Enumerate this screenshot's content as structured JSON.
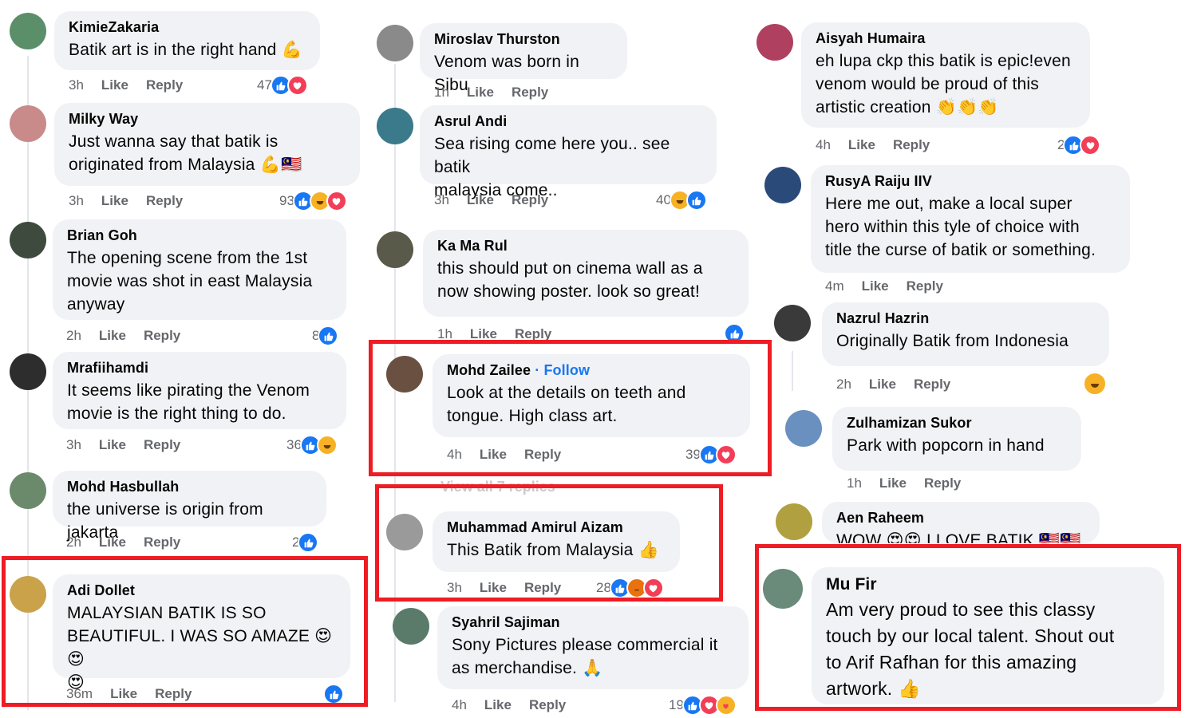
{
  "ui": {
    "like": "Like",
    "reply": "Reply",
    "follow": "Follow",
    "dot": "·"
  },
  "colors": {
    "accent": "#1877f2",
    "bubble": "#f0f2f5",
    "meta": "#65676b",
    "highlight_box": "#ee1c24"
  },
  "comments": [
    {
      "author": "KimieZakaria",
      "lines": [
        "Batik art is in the right hand 💪"
      ],
      "time": "3h",
      "count": "47",
      "reactions": [
        "like",
        "love"
      ]
    },
    {
      "author": "Milky Way",
      "lines": [
        "Just wanna say that batik is",
        "originated from Malaysia 💪🇲🇾"
      ],
      "time": "3h",
      "count": "93",
      "reactions": [
        "like",
        "haha",
        "love"
      ]
    },
    {
      "author": "Brian Goh",
      "lines": [
        "The opening scene from the 1st",
        "movie was shot in east Malaysia",
        "anyway"
      ],
      "time": "2h",
      "count": "8",
      "reactions": [
        "like"
      ]
    },
    {
      "author": "Mrafiihamdi",
      "lines": [
        "It seems like pirating the Venom",
        "movie is the right thing to do."
      ],
      "time": "3h",
      "count": "36",
      "reactions": [
        "like",
        "haha"
      ]
    },
    {
      "author": "Mohd Hasbullah",
      "lines": [
        "the universe is origin from jakarta"
      ],
      "time": "2h",
      "count": "2",
      "reactions": [
        "like"
      ]
    },
    {
      "author": "Adi Dollet",
      "lines": [
        "MALAYSIAN BATIK IS SO",
        "BEAUTIFUL. I WAS SO AMAZE 😍😍",
        "😍"
      ],
      "time": "36m",
      "count": "",
      "reactions": [
        "like"
      ]
    },
    {
      "author": "Miroslav Thurston",
      "lines": [
        "Venom was born in Sibu"
      ],
      "time": "1h",
      "count": "",
      "reactions": []
    },
    {
      "author": "Asrul Andi",
      "lines": [
        "Sea rising come here you.. see batik",
        "malaysia come.."
      ],
      "time": "3h",
      "count": "40",
      "reactions": [
        "haha",
        "like"
      ]
    },
    {
      "author": "Ka Ma Rul",
      "lines": [
        "this should put on cinema wall as a",
        "now showing poster. look so great!"
      ],
      "time": "1h",
      "count": "",
      "reactions": [
        "like"
      ]
    },
    {
      "author": "Mohd Zailee",
      "follow": true,
      "lines": [
        "Look at the details on teeth and",
        "tongue. High class art."
      ],
      "time": "4h",
      "count": "39",
      "reactions": [
        "like",
        "love"
      ]
    },
    {
      "author": "Muhammad Amirul Aizam",
      "lines": [
        "This Batik from Malaysia 👍"
      ],
      "time": "3h",
      "count": "28",
      "reactions": [
        "like",
        "angry",
        "love"
      ]
    },
    {
      "author": "Syahril Sajiman",
      "lines": [
        "Sony Pictures please commercial it",
        "as merchandise. 🙏"
      ],
      "time": "4h",
      "count": "19",
      "reactions": [
        "like",
        "love",
        "care"
      ]
    },
    {
      "author": "Aisyah Humaira",
      "lines": [
        "eh lupa ckp this batik is epic!even",
        "venom would be proud of this",
        "artistic creation 👏👏👏"
      ],
      "time": "4h",
      "count": "2",
      "reactions": [
        "like",
        "love"
      ]
    },
    {
      "author": "RusyA Raiju IIV",
      "lines": [
        "Here me out, make a local super",
        "hero within this tyle of choice with",
        "title the curse of batik or something."
      ],
      "time": "4m",
      "count": "",
      "reactions": []
    },
    {
      "author": "Nazrul Hazrin",
      "lines": [
        "Originally Batik from Indonesia"
      ],
      "time": "2h",
      "count": "",
      "reactions": [
        "haha"
      ]
    },
    {
      "author": "Zulhamizan Sukor",
      "lines": [
        "Park with popcorn in hand"
      ],
      "time": "1h",
      "count": "",
      "reactions": []
    },
    {
      "author": "Aen Raheem",
      "lines": [
        "WOW 😍😍 I LOVE BATIK 🇲🇾🇲🇾"
      ],
      "time": "",
      "count": "",
      "reactions": []
    },
    {
      "author": "Mu Fir",
      "lines": [
        "Am very proud to see this classy",
        "touch by our local talent. Shout out",
        "to Arif Rafhan for this amazing",
        "artwork. 👍"
      ],
      "time": "",
      "count": "",
      "reactions": []
    }
  ],
  "view_replies": "View all 7 replies",
  "avatar_colors": [
    "#5b8f6a",
    "#c98a8a",
    "#3f4a3f",
    "#2d2d2d",
    "#6b8a6b",
    "#c9a24a",
    "#8a8a8a",
    "#3a7a8a",
    "#5a5a4a",
    "#6a5040",
    "#9a9a9a",
    "#5a7a6a",
    "#b04060",
    "#2a4a7a",
    "#3a3a3a",
    "#6a90c0",
    "#b0a040",
    "#6a8a7a"
  ]
}
